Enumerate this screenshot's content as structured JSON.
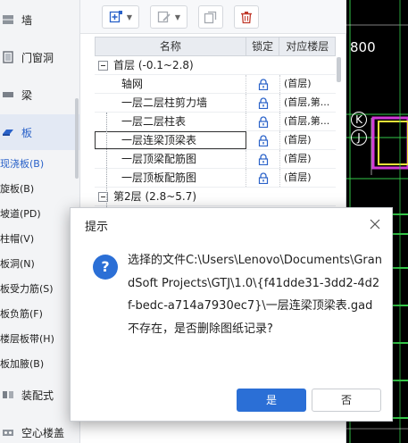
{
  "sidebar": {
    "big_items": [
      {
        "label": "墙",
        "icon": "wall-icon"
      },
      {
        "label": "门窗洞",
        "icon": "door-window-icon"
      },
      {
        "label": "梁",
        "icon": "beam-icon"
      },
      {
        "label": "板",
        "icon": "slab-icon"
      }
    ],
    "small_items": [
      "现浇板(B)",
      "旋板(B)",
      "坡道(PD)",
      "柱帽(V)",
      "板洞(N)",
      "板受力筋(S)",
      "板负筋(F)",
      "楼层板带(H)",
      "板加腋(B)"
    ],
    "bottom_items": [
      {
        "label": "装配式",
        "icon": "prefab-icon"
      },
      {
        "label": "空心楼盖",
        "icon": "hollow-floor-icon"
      }
    ]
  },
  "toolbar": {
    "buttons": [
      "add-layer-icon",
      "edit-layer-icon",
      "copy-layer-icon",
      "delete-icon"
    ]
  },
  "grid": {
    "columns": [
      "名称",
      "锁定",
      "对应楼层"
    ],
    "groups": [
      {
        "label": "首层 (-0.1~2.8)",
        "rows": [
          {
            "name": "轴网",
            "floor": "(首层)"
          },
          {
            "name": "一层二层柱剪力墙",
            "floor": "(首层,第..."
          },
          {
            "name": "一层二层柱表",
            "floor": "(首层,第..."
          },
          {
            "name": "一层连梁顶梁表",
            "floor": "(首层)",
            "selected": true
          },
          {
            "name": "一层顶梁配筋图",
            "floor": "(首层)"
          },
          {
            "name": "一层顶板配筋图",
            "floor": "(首层)"
          }
        ]
      },
      {
        "label": "第2层 (2.8~5.7)",
        "rows": []
      }
    ]
  },
  "canvas": {
    "dimension": "800",
    "axis_labels": [
      "K",
      "J"
    ]
  },
  "dialog": {
    "title": "提示",
    "icon": "question-icon",
    "message": "选择的文件C:\\Users\\Lenovo\\Documents\\GrandSoft Projects\\GTJ\\1.0\\{f41dde31-3dd2-4d2f-bedc-a714a7930ec7}\\一层连梁顶梁表.gad不存在，是否删除图纸记录?",
    "yes_label": "是",
    "no_label": "否"
  },
  "colors": {
    "accent": "#2b6fd6",
    "cad_background": "#000000",
    "cad_green": "#35c94a",
    "cad_magenta": "#d23ad8",
    "cad_yellow": "#f0e23a"
  }
}
